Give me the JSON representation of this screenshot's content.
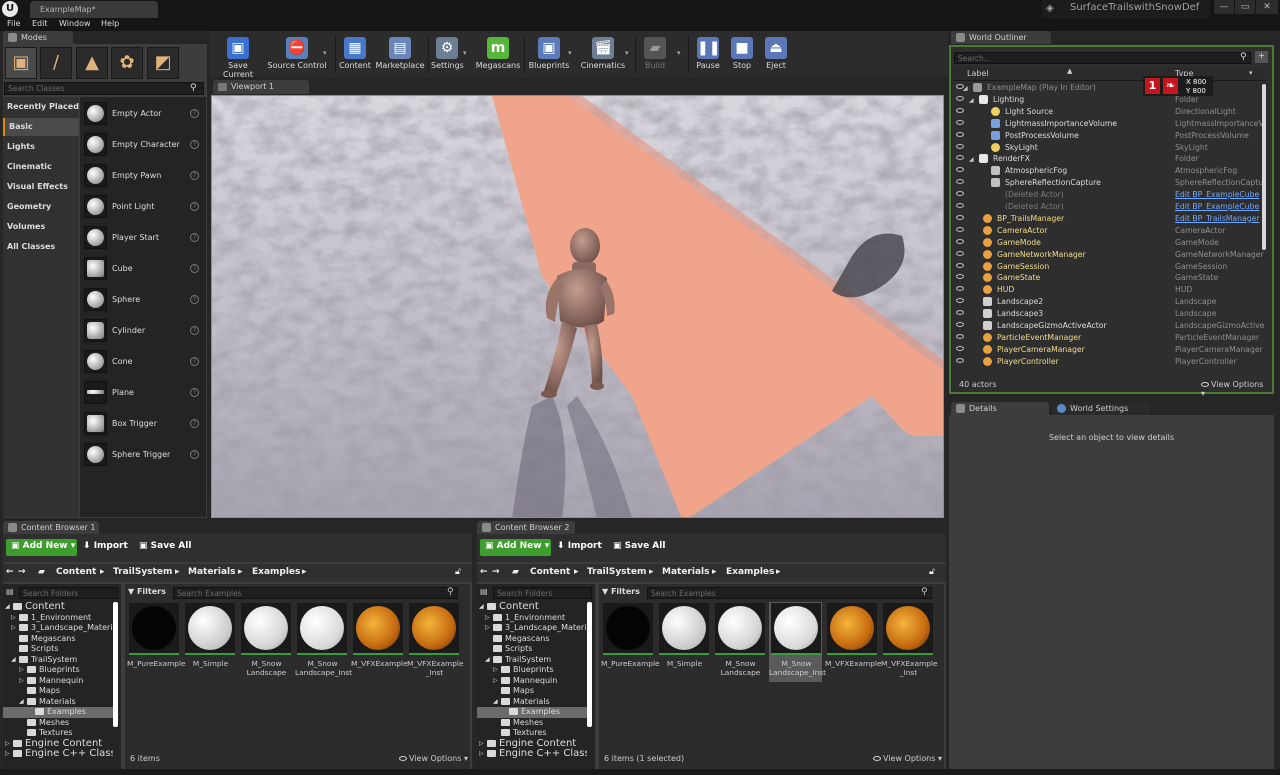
{
  "window": {
    "doc_tab": "ExampleMap*",
    "project": "SurfaceTrailswithSnowDef",
    "min": "—",
    "max": "▭",
    "close": "✕"
  },
  "menu": [
    "File",
    "Edit",
    "Window",
    "Help"
  ],
  "modes": {
    "tab": "Modes",
    "search_placeholder": "Search Classes",
    "categories": [
      "Recently Placed",
      "Basic",
      "Lights",
      "Cinematic",
      "Visual Effects",
      "Geometry",
      "Volumes",
      "All Classes"
    ],
    "selected_category": "Basic",
    "items": [
      "Empty Actor",
      "Empty Character",
      "Empty Pawn",
      "Point Light",
      "Player Start",
      "Cube",
      "Sphere",
      "Cylinder",
      "Cone",
      "Plane",
      "Box Trigger",
      "Sphere Trigger"
    ]
  },
  "toolbar": {
    "save_current": "Save Current",
    "source_control": "Source Control",
    "content": "Content",
    "marketplace": "Marketplace",
    "settings": "Settings",
    "megascans": "Megascans",
    "blueprints": "Blueprints",
    "cinematics": "Cinematics",
    "build": "Build",
    "pause": "Pause",
    "stop": "Stop",
    "eject": "Eject"
  },
  "viewport": {
    "tab": "Viewport 1"
  },
  "outliner": {
    "tab": "World Outliner",
    "search_placeholder": "Search...",
    "col_label": "Label",
    "col_type": "Type",
    "fps": "1",
    "x_readout": "X 800",
    "y_readout": "Y 800",
    "rows": [
      {
        "label": "ExampleMap (Play In Editor)",
        "type": "",
        "kind": "map"
      },
      {
        "label": "Lighting",
        "type": "Folder",
        "kind": "folder"
      },
      {
        "label": "Light Source",
        "type": "DirectionalLight",
        "kind": "light"
      },
      {
        "label": "LightmassImportanceVolume",
        "type": "LightmassImportanceV",
        "kind": "volume"
      },
      {
        "label": "PostProcessVolume",
        "type": "PostProcessVolume",
        "kind": "volume"
      },
      {
        "label": "SkyLight",
        "type": "SkyLight",
        "kind": "light"
      },
      {
        "label": "RenderFX",
        "type": "Folder",
        "kind": "folder"
      },
      {
        "label": "AtmosphericFog",
        "type": "AtmosphericFog",
        "kind": "fx"
      },
      {
        "label": "SphereReflectionCapture",
        "type": "SphereReflectionCaptur",
        "kind": "fx"
      },
      {
        "label": "(Deleted Actor)",
        "type": "Edit BP_ExampleCube",
        "kind": "deleted"
      },
      {
        "label": "(Deleted Actor)",
        "type": "Edit BP_ExampleCube",
        "kind": "deleted"
      },
      {
        "label": "BP_TrailsManager",
        "type": "Edit BP_TrailsManager",
        "kind": "bp"
      },
      {
        "label": "CameraActor",
        "type": "CameraActor",
        "kind": "actor"
      },
      {
        "label": "GameMode",
        "type": "GameMode",
        "kind": "actor"
      },
      {
        "label": "GameNetworkManager",
        "type": "GameNetworkManager",
        "kind": "actor"
      },
      {
        "label": "GameSession",
        "type": "GameSession",
        "kind": "actor"
      },
      {
        "label": "GameState",
        "type": "GameState",
        "kind": "actor"
      },
      {
        "label": "HUD",
        "type": "HUD",
        "kind": "actor"
      },
      {
        "label": "Landscape2",
        "type": "Landscape",
        "kind": "plain"
      },
      {
        "label": "Landscape3",
        "type": "Landscape",
        "kind": "plain"
      },
      {
        "label": "LandscapeGizmoActiveActor",
        "type": "LandscapeGizmoActive",
        "kind": "plain"
      },
      {
        "label": "ParticleEventManager",
        "type": "ParticleEventManager",
        "kind": "actor"
      },
      {
        "label": "PlayerCameraManager",
        "type": "PlayerCameraManager",
        "kind": "actor"
      },
      {
        "label": "PlayerController",
        "type": "PlayerController",
        "kind": "actor"
      }
    ],
    "actor_count": "40 actors",
    "view_options": "View Options"
  },
  "details": {
    "tab": "Details",
    "tab2": "World Settings",
    "empty_message": "Select an object to view details"
  },
  "content_browsers": [
    {
      "tab": "Content Browser 1",
      "add_new": "Add New",
      "import": "Import",
      "save_all": "Save All",
      "breadcrumb": [
        "Content",
        "TrailSystem",
        "Materials",
        "Examples"
      ],
      "search_folders": "Search Folders",
      "filters": "Filters",
      "search_assets": "Search Examples",
      "item_count": "6 items",
      "view_options": "View Options"
    },
    {
      "tab": "Content Browser 2",
      "add_new": "Add New",
      "import": "Import",
      "save_all": "Save All",
      "breadcrumb": [
        "Content",
        "TrailSystem",
        "Materials",
        "Examples"
      ],
      "search_folders": "Search Folders",
      "filters": "Filters",
      "search_assets": "Search Examples",
      "item_count": "6 items (1 selected)",
      "view_options": "View Options"
    }
  ],
  "folder_tree": [
    "Content",
    "1_Environment",
    "3_Landscape_Materi",
    "Megascans",
    "Scripts",
    "TrailSystem",
    "Blueprints",
    "Mannequin",
    "Maps",
    "Materials",
    "Examples",
    "Meshes",
    "Textures",
    "Engine Content",
    "Engine C++ Classes"
  ],
  "assets": [
    "M_PureExample",
    "M_Simple",
    "M_Snow Landscape",
    "M_Snow Landscape_Inst",
    "M_VFXExample",
    "M_VFXExample _Inst"
  ],
  "colors": {
    "accent": "#e08a00",
    "add_new": "#3d9d2d",
    "outliner_border": "#4a7a34",
    "trail": "#f0a48c"
  }
}
